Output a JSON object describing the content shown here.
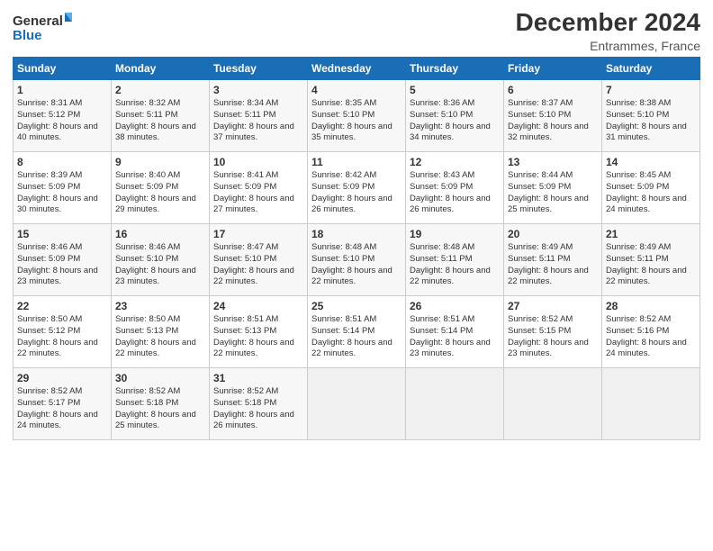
{
  "header": {
    "logo_text_general": "General",
    "logo_text_blue": "Blue",
    "title": "December 2024",
    "location": "Entrammes, France"
  },
  "days_of_week": [
    "Sunday",
    "Monday",
    "Tuesday",
    "Wednesday",
    "Thursday",
    "Friday",
    "Saturday"
  ],
  "weeks": [
    [
      {
        "day": "1",
        "sunrise": "Sunrise: 8:31 AM",
        "sunset": "Sunset: 5:12 PM",
        "daylight": "Daylight: 8 hours and 40 minutes."
      },
      {
        "day": "2",
        "sunrise": "Sunrise: 8:32 AM",
        "sunset": "Sunset: 5:11 PM",
        "daylight": "Daylight: 8 hours and 38 minutes."
      },
      {
        "day": "3",
        "sunrise": "Sunrise: 8:34 AM",
        "sunset": "Sunset: 5:11 PM",
        "daylight": "Daylight: 8 hours and 37 minutes."
      },
      {
        "day": "4",
        "sunrise": "Sunrise: 8:35 AM",
        "sunset": "Sunset: 5:10 PM",
        "daylight": "Daylight: 8 hours and 35 minutes."
      },
      {
        "day": "5",
        "sunrise": "Sunrise: 8:36 AM",
        "sunset": "Sunset: 5:10 PM",
        "daylight": "Daylight: 8 hours and 34 minutes."
      },
      {
        "day": "6",
        "sunrise": "Sunrise: 8:37 AM",
        "sunset": "Sunset: 5:10 PM",
        "daylight": "Daylight: 8 hours and 32 minutes."
      },
      {
        "day": "7",
        "sunrise": "Sunrise: 8:38 AM",
        "sunset": "Sunset: 5:10 PM",
        "daylight": "Daylight: 8 hours and 31 minutes."
      }
    ],
    [
      {
        "day": "8",
        "sunrise": "Sunrise: 8:39 AM",
        "sunset": "Sunset: 5:09 PM",
        "daylight": "Daylight: 8 hours and 30 minutes."
      },
      {
        "day": "9",
        "sunrise": "Sunrise: 8:40 AM",
        "sunset": "Sunset: 5:09 PM",
        "daylight": "Daylight: 8 hours and 29 minutes."
      },
      {
        "day": "10",
        "sunrise": "Sunrise: 8:41 AM",
        "sunset": "Sunset: 5:09 PM",
        "daylight": "Daylight: 8 hours and 27 minutes."
      },
      {
        "day": "11",
        "sunrise": "Sunrise: 8:42 AM",
        "sunset": "Sunset: 5:09 PM",
        "daylight": "Daylight: 8 hours and 26 minutes."
      },
      {
        "day": "12",
        "sunrise": "Sunrise: 8:43 AM",
        "sunset": "Sunset: 5:09 PM",
        "daylight": "Daylight: 8 hours and 26 minutes."
      },
      {
        "day": "13",
        "sunrise": "Sunrise: 8:44 AM",
        "sunset": "Sunset: 5:09 PM",
        "daylight": "Daylight: 8 hours and 25 minutes."
      },
      {
        "day": "14",
        "sunrise": "Sunrise: 8:45 AM",
        "sunset": "Sunset: 5:09 PM",
        "daylight": "Daylight: 8 hours and 24 minutes."
      }
    ],
    [
      {
        "day": "15",
        "sunrise": "Sunrise: 8:46 AM",
        "sunset": "Sunset: 5:09 PM",
        "daylight": "Daylight: 8 hours and 23 minutes."
      },
      {
        "day": "16",
        "sunrise": "Sunrise: 8:46 AM",
        "sunset": "Sunset: 5:10 PM",
        "daylight": "Daylight: 8 hours and 23 minutes."
      },
      {
        "day": "17",
        "sunrise": "Sunrise: 8:47 AM",
        "sunset": "Sunset: 5:10 PM",
        "daylight": "Daylight: 8 hours and 22 minutes."
      },
      {
        "day": "18",
        "sunrise": "Sunrise: 8:48 AM",
        "sunset": "Sunset: 5:10 PM",
        "daylight": "Daylight: 8 hours and 22 minutes."
      },
      {
        "day": "19",
        "sunrise": "Sunrise: 8:48 AM",
        "sunset": "Sunset: 5:11 PM",
        "daylight": "Daylight: 8 hours and 22 minutes."
      },
      {
        "day": "20",
        "sunrise": "Sunrise: 8:49 AM",
        "sunset": "Sunset: 5:11 PM",
        "daylight": "Daylight: 8 hours and 22 minutes."
      },
      {
        "day": "21",
        "sunrise": "Sunrise: 8:49 AM",
        "sunset": "Sunset: 5:11 PM",
        "daylight": "Daylight: 8 hours and 22 minutes."
      }
    ],
    [
      {
        "day": "22",
        "sunrise": "Sunrise: 8:50 AM",
        "sunset": "Sunset: 5:12 PM",
        "daylight": "Daylight: 8 hours and 22 minutes."
      },
      {
        "day": "23",
        "sunrise": "Sunrise: 8:50 AM",
        "sunset": "Sunset: 5:13 PM",
        "daylight": "Daylight: 8 hours and 22 minutes."
      },
      {
        "day": "24",
        "sunrise": "Sunrise: 8:51 AM",
        "sunset": "Sunset: 5:13 PM",
        "daylight": "Daylight: 8 hours and 22 minutes."
      },
      {
        "day": "25",
        "sunrise": "Sunrise: 8:51 AM",
        "sunset": "Sunset: 5:14 PM",
        "daylight": "Daylight: 8 hours and 22 minutes."
      },
      {
        "day": "26",
        "sunrise": "Sunrise: 8:51 AM",
        "sunset": "Sunset: 5:14 PM",
        "daylight": "Daylight: 8 hours and 23 minutes."
      },
      {
        "day": "27",
        "sunrise": "Sunrise: 8:52 AM",
        "sunset": "Sunset: 5:15 PM",
        "daylight": "Daylight: 8 hours and 23 minutes."
      },
      {
        "day": "28",
        "sunrise": "Sunrise: 8:52 AM",
        "sunset": "Sunset: 5:16 PM",
        "daylight": "Daylight: 8 hours and 24 minutes."
      }
    ],
    [
      {
        "day": "29",
        "sunrise": "Sunrise: 8:52 AM",
        "sunset": "Sunset: 5:17 PM",
        "daylight": "Daylight: 8 hours and 24 minutes."
      },
      {
        "day": "30",
        "sunrise": "Sunrise: 8:52 AM",
        "sunset": "Sunset: 5:18 PM",
        "daylight": "Daylight: 8 hours and 25 minutes."
      },
      {
        "day": "31",
        "sunrise": "Sunrise: 8:52 AM",
        "sunset": "Sunset: 5:18 PM",
        "daylight": "Daylight: 8 hours and 26 minutes."
      },
      null,
      null,
      null,
      null
    ]
  ]
}
